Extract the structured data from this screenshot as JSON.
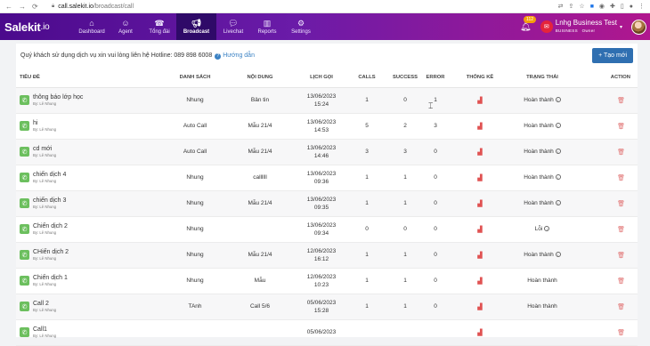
{
  "browser": {
    "url_host": "call.salekit.io",
    "url_path": "/broadcast/call"
  },
  "app": {
    "logo_main": "Salekit",
    "logo_suffix": ".io",
    "menu": [
      {
        "label": "Dashboard",
        "icon": "home-icon"
      },
      {
        "label": "Agent",
        "icon": "users-icon"
      },
      {
        "label": "Tổng đài",
        "icon": "phone-icon"
      },
      {
        "label": "Broadcast",
        "icon": "megaphone-icon"
      },
      {
        "label": "Livechat",
        "icon": "chat-icon"
      },
      {
        "label": "Reports",
        "icon": "bar-chart-icon"
      },
      {
        "label": "Settings",
        "icon": "gear-icon"
      }
    ],
    "notifications": "112",
    "business_name": "Lnhg Business Test",
    "business_sub": "BUSINESS",
    "business_role": "Owner"
  },
  "page": {
    "notice": "Quý khách sử dụng dịch vụ xin vui lòng liên hệ Hotline: 089 898 6008",
    "help_link": "Hướng dẫn",
    "new_button": "+ Tạo mới",
    "columns": [
      "TIÊU ĐỀ",
      "DANH SÁCH",
      "NỘI DUNG",
      "LỊCH GỌI",
      "CALLS",
      "SUCCESS",
      "ERROR",
      "THỐNG KÊ",
      "TRẠNG THÁI",
      "ACTION"
    ],
    "rows": [
      {
        "title": "thông báo lớp học",
        "by": "By: Lê Nhung",
        "list": "Nhung",
        "content": "Bản tin",
        "date": "13/06/2023",
        "time": "15:24",
        "calls": "1",
        "success": "0",
        "error": "1",
        "status": "Hoàn thành",
        "info": true
      },
      {
        "title": "hi",
        "by": "By: Lê Nhung",
        "list": "Auto Call",
        "content": "Mẫu 21/4",
        "date": "13/06/2023",
        "time": "14:53",
        "calls": "5",
        "success": "2",
        "error": "3",
        "status": "Hoàn thành",
        "info": true
      },
      {
        "title": "cd mới",
        "by": "By: Lê Nhung",
        "list": "Auto Call",
        "content": "Mẫu 21/4",
        "date": "13/06/2023",
        "time": "14:46",
        "calls": "3",
        "success": "3",
        "error": "0",
        "status": "Hoàn thành",
        "info": true
      },
      {
        "title": "chiến dịch 4",
        "by": "By: Lê Nhung",
        "list": "Nhung",
        "content": "callllll",
        "date": "13/06/2023",
        "time": "09:36",
        "calls": "1",
        "success": "1",
        "error": "0",
        "status": "Hoàn thành",
        "info": true
      },
      {
        "title": "chiến dịch 3",
        "by": "By: Lê Nhung",
        "list": "Nhung",
        "content": "Mẫu 21/4",
        "date": "13/06/2023",
        "time": "09:35",
        "calls": "1",
        "success": "1",
        "error": "0",
        "status": "Hoàn thành",
        "info": true
      },
      {
        "title": "Chiến dịch 2",
        "by": "By: Lê Nhung",
        "list": "Nhung",
        "content": "",
        "date": "13/06/2023",
        "time": "09:34",
        "calls": "0",
        "success": "0",
        "error": "0",
        "status": "Lỗi",
        "info": true
      },
      {
        "title": "CHiến dịch 2",
        "by": "By: Lê Nhung",
        "list": "Nhung",
        "content": "Mẫu 21/4",
        "date": "12/06/2023",
        "time": "16:12",
        "calls": "1",
        "success": "1",
        "error": "0",
        "status": "Hoàn thành",
        "info": true
      },
      {
        "title": "Chiến dịch 1",
        "by": "By: Lê Nhung",
        "list": "Nhung",
        "content": "Mẫu",
        "date": "12/06/2023",
        "time": "10:23",
        "calls": "1",
        "success": "1",
        "error": "0",
        "status": "Hoàn thành",
        "info": false
      },
      {
        "title": "Call 2",
        "by": "By: Lê Nhung",
        "list": "TAnh",
        "content": "Call 5/6",
        "date": "05/06/2023",
        "time": "15:28",
        "calls": "1",
        "success": "1",
        "error": "0",
        "status": "Hoàn thành",
        "info": false
      },
      {
        "title": "Call1",
        "by": "By: Lê Nhung",
        "list": "",
        "content": "",
        "date": "05/06/2023",
        "time": "",
        "calls": "",
        "success": "",
        "error": "",
        "status": "",
        "info": false
      }
    ]
  }
}
